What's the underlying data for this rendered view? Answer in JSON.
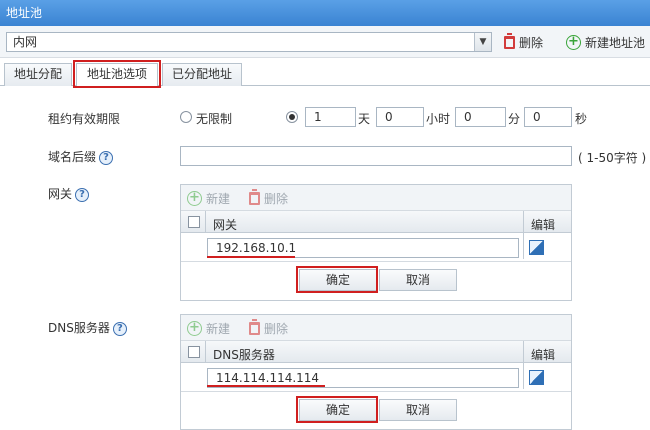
{
  "window": {
    "title": "地址池"
  },
  "pool": {
    "selected": "内网",
    "delete_label": "删除",
    "new_label": "新建地址池"
  },
  "tabs": [
    {
      "label": "地址分配"
    },
    {
      "label": "地址池选项"
    },
    {
      "label": "已分配地址"
    }
  ],
  "lease": {
    "label": "租约有效期限",
    "unlimited_label": "无限制",
    "days": "1",
    "days_unit": "天",
    "hours": "0",
    "hours_unit": "小时",
    "minutes": "0",
    "minutes_unit": "分",
    "seconds": "0",
    "seconds_unit": "秒"
  },
  "domain": {
    "label": "域名后缀",
    "value": "",
    "hint": "( 1-50字符 )"
  },
  "gateway": {
    "label": "网关",
    "new_label": "新建",
    "delete_label": "删除",
    "col_name": "网关",
    "col_edit": "编辑",
    "value": "192.168.10.1",
    "ok_label": "确定",
    "cancel_label": "取消"
  },
  "dns": {
    "label": "DNS服务器",
    "new_label": "新建",
    "delete_label": "删除",
    "col_name": "DNS服务器",
    "col_edit": "编辑",
    "value": "114.114.114.114",
    "ok_label": "确定",
    "cancel_label": "取消"
  },
  "colors": {
    "titlebar": "#3a83d2",
    "highlight": "#d01f1f",
    "accent_green": "#3aa53a",
    "delete_red": "#d23c3c"
  }
}
